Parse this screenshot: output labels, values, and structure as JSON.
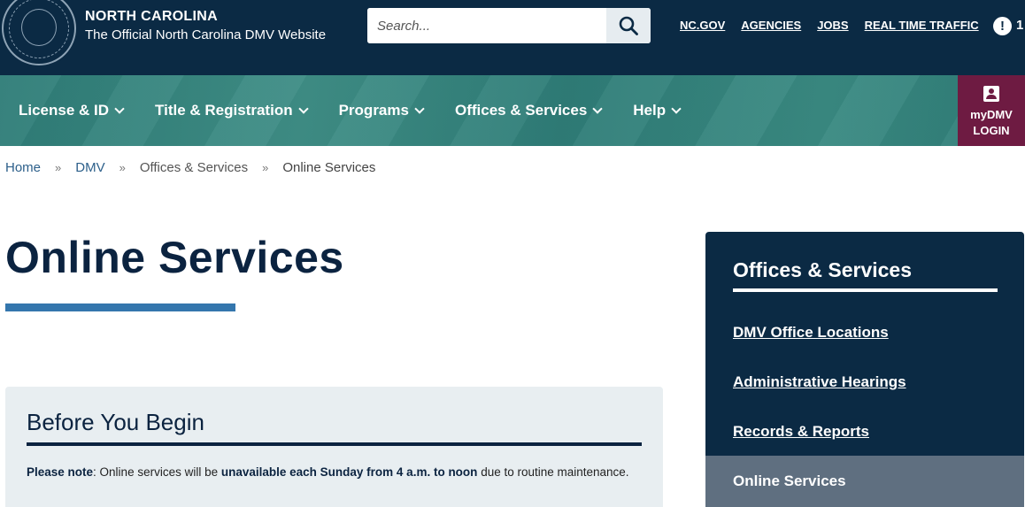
{
  "header": {
    "title": "NORTH CAROLINA",
    "subtitle": "The Official North Carolina DMV Website",
    "logo_icon": "nc-state-seal-icon",
    "search": {
      "placeholder": "Search...",
      "icon": "search-icon"
    },
    "links": [
      "NC.GOV",
      "AGENCIES",
      "JOBS",
      "REAL TIME TRAFFIC"
    ],
    "alert_icon": "!",
    "alert_count": "1"
  },
  "nav": {
    "items": [
      {
        "label": "License & ID"
      },
      {
        "label": "Title & Registration"
      },
      {
        "label": "Programs"
      },
      {
        "label": "Offices & Services"
      },
      {
        "label": "Help"
      }
    ],
    "login": {
      "line1": "myDMV",
      "line2": "LOGIN",
      "icon": "account-icon",
      "color": "#6e1b42"
    }
  },
  "breadcrumb": {
    "items": [
      "Home",
      "DMV",
      "Offices & Services"
    ],
    "separator": "»",
    "current": "Online Services"
  },
  "main": {
    "title": "Online Services",
    "notice": {
      "heading": "Before You Begin",
      "label": "Please note",
      "text_before": ": Online services will be ",
      "emphasis": "unavailable each Sunday from 4 a.m. to noon",
      "text_after": " due to routine maintenance."
    }
  },
  "sidebar": {
    "title": "Offices & Services",
    "links": [
      "DMV Office Locations",
      "Administrative Hearings",
      "Records & Reports"
    ],
    "active": "Online Services"
  },
  "colors": {
    "header_bg": "#0b2a44",
    "nav_bg": "#2f7d78",
    "accent_blue": "#3476ad",
    "login_bg": "#6e1b42",
    "active_item": "#5f6f80"
  }
}
